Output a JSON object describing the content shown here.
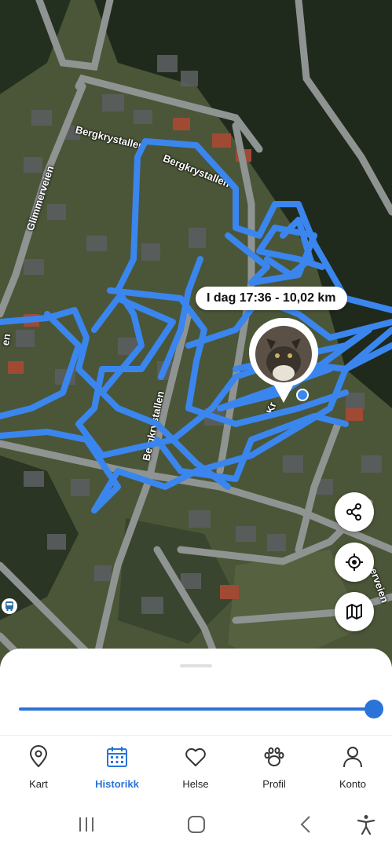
{
  "map": {
    "streets": [
      "Bergkrystallen",
      "Bergkrystallen",
      "Glimmerveien",
      "Bergkrystallen",
      "Kr",
      "en",
      "erveien"
    ],
    "track_label": "I dag 17:36 - 10,02 km",
    "track_color": "#3a86ee",
    "buttons": [
      "share-icon",
      "locate-icon",
      "map-layers-icon"
    ]
  },
  "slider": {
    "value_fraction": 1.0,
    "color": "#2a73d9"
  },
  "tabs": [
    {
      "label": "Kart",
      "icon": "location-pin-icon",
      "active": false
    },
    {
      "label": "Historikk",
      "icon": "calendar-icon",
      "active": true
    },
    {
      "label": "Helse",
      "icon": "heart-icon",
      "active": false
    },
    {
      "label": "Profil",
      "icon": "paw-icon",
      "active": false
    },
    {
      "label": "Konto",
      "icon": "person-icon",
      "active": false
    }
  ],
  "system_nav": [
    "recents-icon",
    "home-icon",
    "back-icon",
    "accessibility-icon"
  ]
}
